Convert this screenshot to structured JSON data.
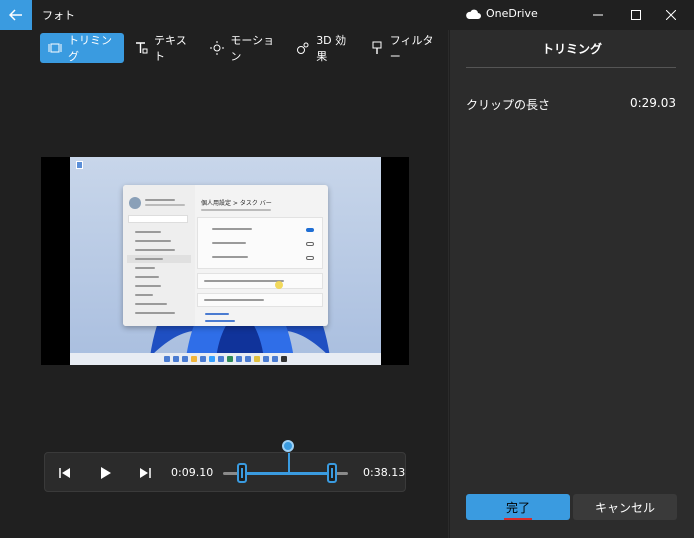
{
  "window": {
    "title": "フォト",
    "cloud_label": "OneDrive"
  },
  "toolbar": {
    "items": [
      {
        "label": "トリミング",
        "icon": "trim-icon",
        "active": true
      },
      {
        "label": "テキスト",
        "icon": "text-icon",
        "active": false
      },
      {
        "label": "モーション",
        "icon": "motion-icon",
        "active": false
      },
      {
        "label": "3D 効果",
        "icon": "3d-effects-icon",
        "active": false
      },
      {
        "label": "フィルター",
        "icon": "filter-icon",
        "active": false
      }
    ]
  },
  "preview": {
    "settings_heading": "個人用設定 > タスク バー"
  },
  "scrubber": {
    "start_time": "0:09.10",
    "end_time": "0:38.13",
    "trim_start_fraction": 0.15,
    "trim_end_fraction": 0.87,
    "playhead_fraction": 0.53
  },
  "panel": {
    "title": "トリミング",
    "clip_length_label": "クリップの長さ",
    "clip_length_value": "0:29.03",
    "done_label": "完了",
    "cancel_label": "キャンセル"
  },
  "colors": {
    "accent": "#3a9be0",
    "background": "#202020",
    "panel": "#2c2c2c",
    "annotation_underline": "#d92c2c"
  }
}
